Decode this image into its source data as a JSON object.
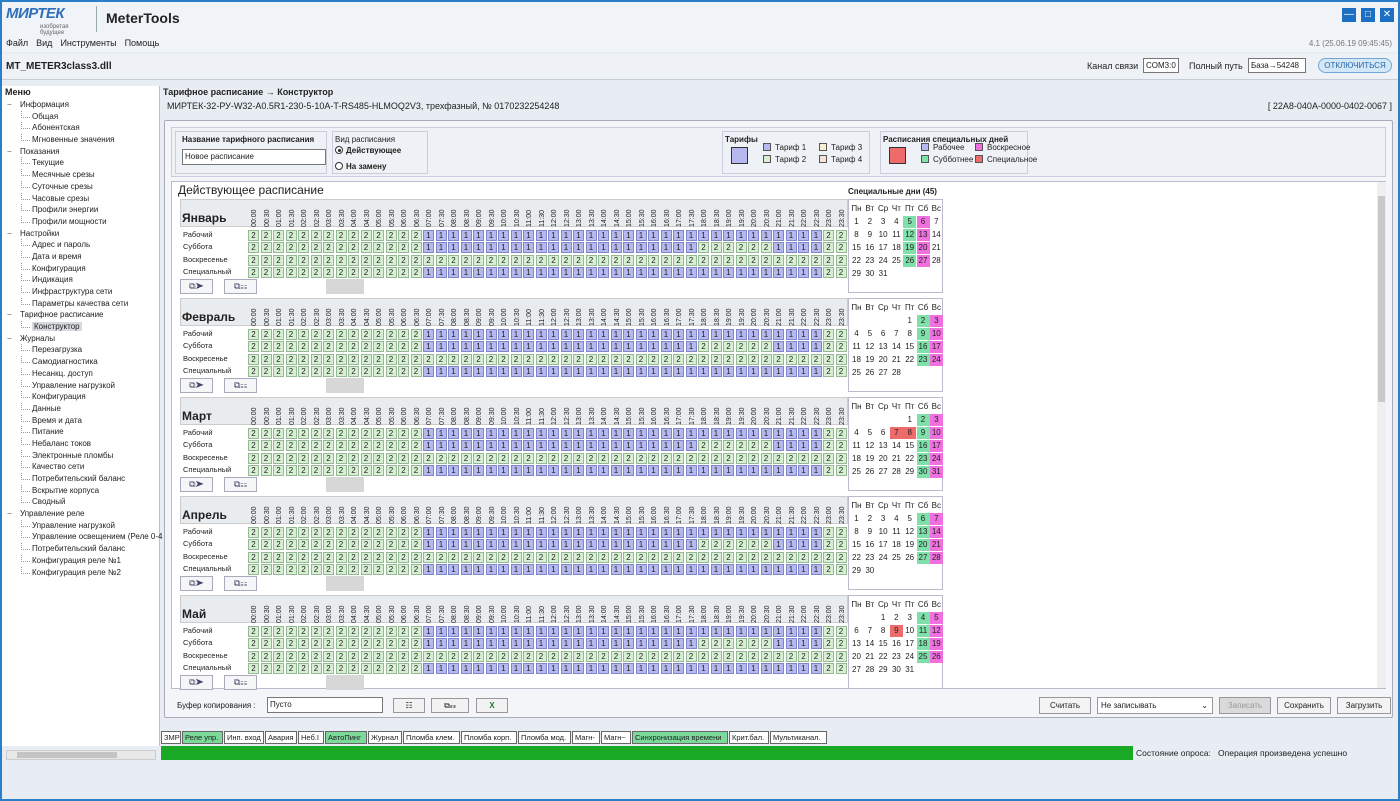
{
  "app": {
    "logo": "МИРТЕК",
    "logo_sub": "изобретая будущее",
    "title": "MeterTools",
    "version": "4.1 (25.06.19 09:45:45)"
  },
  "menu": [
    "Файл",
    "Вид",
    "Инструменты",
    "Помощь"
  ],
  "device_file": "MT_METER3class3.dll",
  "connection": {
    "channel_label": "Канал связи",
    "channel_value": "COM3:0",
    "path_label": "Полный путь",
    "path_value": "База→54248",
    "disconnect": "ОТКЛЮЧИТЬСЯ"
  },
  "sidebar": {
    "title": "Меню",
    "tree": [
      {
        "t": "Информация",
        "l": 0
      },
      {
        "t": "Общая",
        "l": 1
      },
      {
        "t": "Абонентская",
        "l": 1
      },
      {
        "t": "Мгновенные значения",
        "l": 1
      },
      {
        "t": "Показания",
        "l": 0
      },
      {
        "t": "Текущие",
        "l": 1
      },
      {
        "t": "Месячные срезы",
        "l": 1
      },
      {
        "t": "Суточные срезы",
        "l": 1
      },
      {
        "t": "Часовые срезы",
        "l": 1
      },
      {
        "t": "Профили энергии",
        "l": 1
      },
      {
        "t": "Профили мощности",
        "l": 1
      },
      {
        "t": "Настройки",
        "l": 0
      },
      {
        "t": "Адрес и пароль",
        "l": 1
      },
      {
        "t": "Дата и время",
        "l": 1
      },
      {
        "t": "Конфигурация",
        "l": 1
      },
      {
        "t": "Индикация",
        "l": 1
      },
      {
        "t": "Инфраструктура сети",
        "l": 1
      },
      {
        "t": "Параметры качества сети",
        "l": 1
      },
      {
        "t": "Тарифное расписание",
        "l": 0
      },
      {
        "t": "Конструктор",
        "l": 1,
        "sel": true
      },
      {
        "t": "Журналы",
        "l": 0
      },
      {
        "t": "Перезагрузка",
        "l": 1
      },
      {
        "t": "Самодиагностика",
        "l": 1
      },
      {
        "t": "Несанкц. доступ",
        "l": 1
      },
      {
        "t": "Управление нагрузкой",
        "l": 1
      },
      {
        "t": "Конфигурация",
        "l": 1
      },
      {
        "t": "Данные",
        "l": 1
      },
      {
        "t": "Время и дата",
        "l": 1
      },
      {
        "t": "Питание",
        "l": 1
      },
      {
        "t": "Небаланс токов",
        "l": 1
      },
      {
        "t": "Электронные пломбы",
        "l": 1
      },
      {
        "t": "Качество сети",
        "l": 1
      },
      {
        "t": "Потребительский баланс",
        "l": 1
      },
      {
        "t": "Вскрытие корпуса",
        "l": 1
      },
      {
        "t": "Сводный",
        "l": 1
      },
      {
        "t": "Управление реле",
        "l": 0
      },
      {
        "t": "Управление нагрузкой",
        "l": 1
      },
      {
        "t": "Управление освещением (Реле 0-4",
        "l": 1
      },
      {
        "t": "Потребительский баланс",
        "l": 1
      },
      {
        "t": "Конфигурация реле №1",
        "l": 1
      },
      {
        "t": "Конфигурация реле №2",
        "l": 1
      }
    ]
  },
  "page": {
    "breadcrumb": "Тарифное расписание → Конструктор",
    "device": "МИРТЕК-32-РУ-W32-A0.5R1-230-5-10A-T-RS485-HLMOQ2V3, трехфазный, № 0170232254248",
    "device_id": "[ 22A8-040A-0000-0402-0067 ]"
  },
  "toolbar": {
    "name_label": "Название тарифного расписания",
    "name_value": "Новое расписание",
    "kind_label": "Вид расписания",
    "kind_opts": [
      "Действующее",
      "На замену"
    ],
    "tariffs_label": "Тарифы",
    "tariffs": [
      {
        "n": "Тариф 1",
        "c": "#b5b9ef"
      },
      {
        "n": "Тариф 2",
        "c": "#d7f0d3"
      },
      {
        "n": "Тариф 3",
        "c": "#f7eed5"
      },
      {
        "n": "Тариф 4",
        "c": "#f7e2d8"
      }
    ],
    "special_label": "Расписания специальных дней",
    "special": [
      {
        "n": "Рабочее",
        "c": "#b5b9ef"
      },
      {
        "n": "Субботнее",
        "c": "#7fe0aa"
      },
      {
        "n": "Воскресное",
        "c": "#f170e0"
      },
      {
        "n": "Специальное",
        "c": "#ee6b6b"
      }
    ]
  },
  "schedule": {
    "title": "Действующее расписание",
    "special_title": "Специальные дни (45)",
    "hours": [
      "00:00",
      "00:30",
      "01:00",
      "01:30",
      "02:00",
      "02:30",
      "03:00",
      "03:30",
      "04:00",
      "04:30",
      "05:00",
      "05:30",
      "06:00",
      "06:30",
      "07:00",
      "07:30",
      "08:00",
      "08:30",
      "09:00",
      "09:30",
      "10:00",
      "10:30",
      "11:00",
      "11:30",
      "12:00",
      "12:30",
      "13:00",
      "13:30",
      "14:00",
      "14:30",
      "15:00",
      "15:30",
      "16:00",
      "16:30",
      "17:00",
      "17:30",
      "18:00",
      "18:30",
      "19:00",
      "19:30",
      "20:00",
      "20:30",
      "21:00",
      "21:30",
      "22:00",
      "22:30",
      "23:00",
      "23:30"
    ],
    "day_types": [
      "Рабочий",
      "Суббота",
      "Воскресенье",
      "Специальный"
    ],
    "weekdays": [
      "Пн",
      "Вт",
      "Ср",
      "Чт",
      "Пт",
      "Сб",
      "Вс"
    ],
    "months": [
      {
        "name": "Январь",
        "start": 0,
        "days": 31,
        "w": [
          5,
          12,
          19,
          26
        ],
        "s": [
          6,
          13,
          20,
          27
        ],
        "x": []
      },
      {
        "name": "Февраль",
        "start": 4,
        "days": 28,
        "w": [
          2,
          9,
          16,
          23
        ],
        "s": [
          3,
          10,
          17,
          24
        ],
        "x": []
      },
      {
        "name": "Март",
        "start": 4,
        "days": 31,
        "w": [
          2,
          9,
          16,
          23,
          30
        ],
        "s": [
          3,
          10,
          17,
          24,
          31
        ],
        "x": [
          7,
          8
        ]
      },
      {
        "name": "Апрель",
        "start": 0,
        "days": 30,
        "w": [
          6,
          13,
          20,
          27
        ],
        "s": [
          7,
          14,
          21,
          28
        ],
        "x": []
      },
      {
        "name": "Май",
        "start": 2,
        "days": 31,
        "w": [
          4,
          11,
          18,
          25
        ],
        "s": [
          5,
          12,
          19,
          26
        ],
        "x": [
          9
        ]
      }
    ]
  },
  "bottom": {
    "buffer_label": "Буфер копирования :",
    "buffer_value": "Пусто",
    "read": "Считать",
    "mode": "Не записывать",
    "write": "Записать",
    "save": "Сохранить",
    "load": "Загрузить"
  },
  "tags": [
    {
      "t": "ЗМР",
      "on": false
    },
    {
      "t": "Реле упр.",
      "on": true
    },
    {
      "t": "Инп. вход",
      "on": false
    },
    {
      "t": "Авария",
      "on": false
    },
    {
      "t": "Неб.I",
      "on": false
    },
    {
      "t": "АвтоПинг",
      "on": true
    },
    {
      "t": "Журнал",
      "on": false
    },
    {
      "t": "Пломба клем.",
      "on": false
    },
    {
      "t": "Пломба корп.",
      "on": false
    },
    {
      "t": "Пломба мод.",
      "on": false
    },
    {
      "t": "Магн-",
      "on": false
    },
    {
      "t": "Магн~",
      "on": false
    },
    {
      "t": "Синхронизация времени",
      "on": true
    },
    {
      "t": "Крит.бал.",
      "on": false
    },
    {
      "t": "Мультиканал.",
      "on": false
    }
  ],
  "status": {
    "label": "Состояние опроса:",
    "value": "Операция произведена успешно"
  }
}
